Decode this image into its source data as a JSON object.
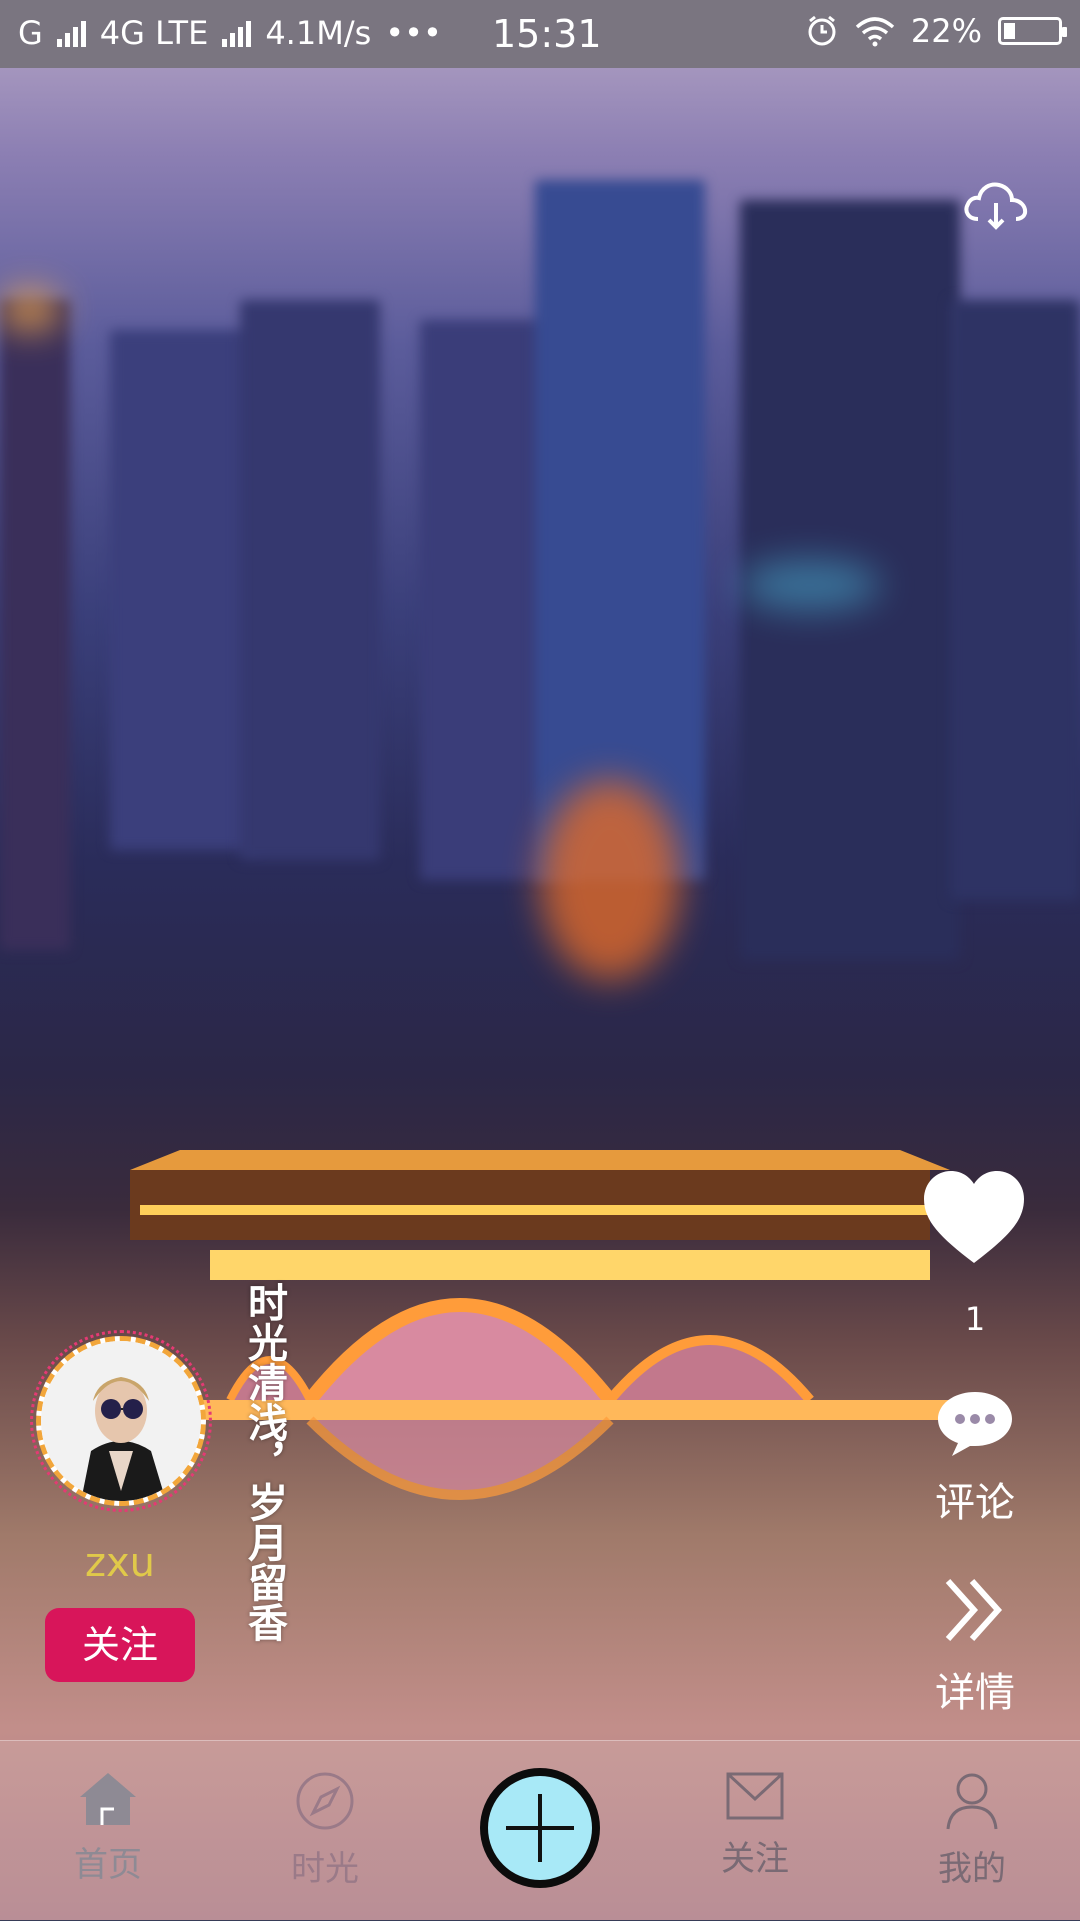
{
  "status_bar": {
    "carrier_text": "G",
    "network_text": "4G LTE",
    "speed_text": "4.1M/s",
    "dots_text": "•••",
    "time": "15:31",
    "battery_text": "22%",
    "battery_level": 0.22,
    "icons": [
      "signal-icon",
      "alarm-icon",
      "wifi-icon",
      "battery-icon"
    ]
  },
  "post": {
    "caption": "时光清浅，岁月留香",
    "like_count": "1"
  },
  "author": {
    "username": "zxu",
    "follow_label": "关注"
  },
  "actions": {
    "download_icon": "cloud-download-icon",
    "like_icon": "heart-icon",
    "comment_label": "评论",
    "comment_icon": "comment-bubble-icon",
    "detail_label": "详情",
    "detail_icon": "double-chevron-right-icon"
  },
  "nav": {
    "items": [
      {
        "label": "首页",
        "icon": "home-icon"
      },
      {
        "label": "时光",
        "icon": "compass-icon"
      },
      {
        "label": "关注",
        "icon": "mail-icon"
      },
      {
        "label": "我的",
        "icon": "user-icon"
      }
    ],
    "add_icon": "plus-icon"
  },
  "colors": {
    "follow_button": "#d8155a",
    "username": "#e0c94a",
    "add_button": "#a8e9f7"
  }
}
